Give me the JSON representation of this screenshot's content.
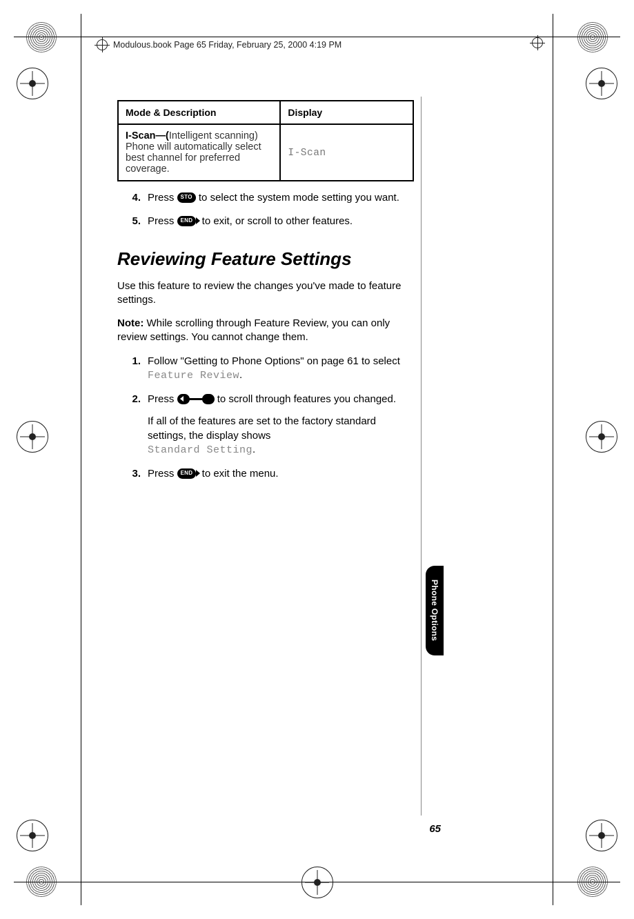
{
  "header": {
    "running_head": "Modulous.book  Page 65  Friday, February 25, 2000  4:19 PM"
  },
  "table": {
    "headers": {
      "col1": "Mode & Description",
      "col2": "Display"
    },
    "row": {
      "mode_label": "I-Scan—(",
      "mode_paren": "Intelligent scanning)",
      "mode_desc": "Phone will automatically select best channel for preferred coverage.",
      "display": "I-Scan"
    }
  },
  "keys": {
    "sto": "STO",
    "end": "END"
  },
  "steps_a": {
    "s4": {
      "num": "4.",
      "pre": "Press ",
      "post": " to select the system mode setting you want."
    },
    "s5": {
      "num": "5.",
      "pre": "Press ",
      "post": " to exit, or scroll to other features."
    }
  },
  "section": {
    "title": "Reviewing Feature Settings",
    "intro": "Use this feature to review the changes you've made to feature settings.",
    "note_label": "Note:",
    "note_body": " While scrolling through Feature Review, you can only review settings. You cannot change them."
  },
  "steps_b": {
    "s1": {
      "num": "1.",
      "text_a": "Follow \"Getting to Phone Options\" on page 61 to select ",
      "lcd": "Feature Review",
      "text_b": "."
    },
    "s2": {
      "num": "2.",
      "pre": "Press ",
      "post": " to scroll through features you changed.",
      "para_a": "If all of the features are set to the factory standard settings, the display shows ",
      "para_lcd": "Standard Setting",
      "para_b": "."
    },
    "s3": {
      "num": "3.",
      "pre": "Press ",
      "post": " to exit the menu."
    }
  },
  "side_tab": "Phone Options",
  "page_number": "65"
}
